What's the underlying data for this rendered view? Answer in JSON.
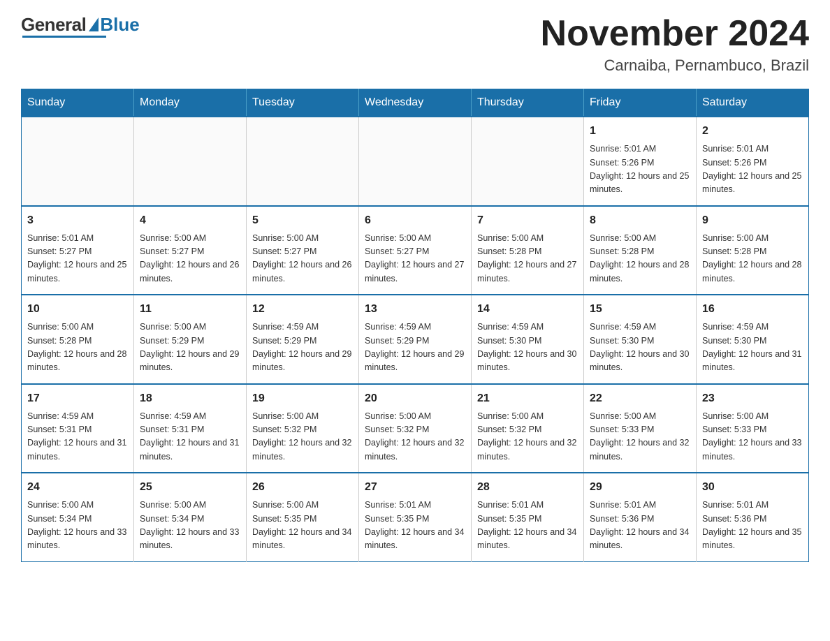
{
  "logo": {
    "general": "General",
    "blue": "Blue",
    "triangle_color": "#1a6fa8"
  },
  "header": {
    "month_year": "November 2024",
    "location": "Carnaiba, Pernambuco, Brazil"
  },
  "weekdays": [
    "Sunday",
    "Monday",
    "Tuesday",
    "Wednesday",
    "Thursday",
    "Friday",
    "Saturday"
  ],
  "weeks": [
    [
      {
        "day": "",
        "sunrise": "",
        "sunset": "",
        "daylight": ""
      },
      {
        "day": "",
        "sunrise": "",
        "sunset": "",
        "daylight": ""
      },
      {
        "day": "",
        "sunrise": "",
        "sunset": "",
        "daylight": ""
      },
      {
        "day": "",
        "sunrise": "",
        "sunset": "",
        "daylight": ""
      },
      {
        "day": "",
        "sunrise": "",
        "sunset": "",
        "daylight": ""
      },
      {
        "day": "1",
        "sunrise": "Sunrise: 5:01 AM",
        "sunset": "Sunset: 5:26 PM",
        "daylight": "Daylight: 12 hours and 25 minutes."
      },
      {
        "day": "2",
        "sunrise": "Sunrise: 5:01 AM",
        "sunset": "Sunset: 5:26 PM",
        "daylight": "Daylight: 12 hours and 25 minutes."
      }
    ],
    [
      {
        "day": "3",
        "sunrise": "Sunrise: 5:01 AM",
        "sunset": "Sunset: 5:27 PM",
        "daylight": "Daylight: 12 hours and 25 minutes."
      },
      {
        "day": "4",
        "sunrise": "Sunrise: 5:00 AM",
        "sunset": "Sunset: 5:27 PM",
        "daylight": "Daylight: 12 hours and 26 minutes."
      },
      {
        "day": "5",
        "sunrise": "Sunrise: 5:00 AM",
        "sunset": "Sunset: 5:27 PM",
        "daylight": "Daylight: 12 hours and 26 minutes."
      },
      {
        "day": "6",
        "sunrise": "Sunrise: 5:00 AM",
        "sunset": "Sunset: 5:27 PM",
        "daylight": "Daylight: 12 hours and 27 minutes."
      },
      {
        "day": "7",
        "sunrise": "Sunrise: 5:00 AM",
        "sunset": "Sunset: 5:28 PM",
        "daylight": "Daylight: 12 hours and 27 minutes."
      },
      {
        "day": "8",
        "sunrise": "Sunrise: 5:00 AM",
        "sunset": "Sunset: 5:28 PM",
        "daylight": "Daylight: 12 hours and 28 minutes."
      },
      {
        "day": "9",
        "sunrise": "Sunrise: 5:00 AM",
        "sunset": "Sunset: 5:28 PM",
        "daylight": "Daylight: 12 hours and 28 minutes."
      }
    ],
    [
      {
        "day": "10",
        "sunrise": "Sunrise: 5:00 AM",
        "sunset": "Sunset: 5:28 PM",
        "daylight": "Daylight: 12 hours and 28 minutes."
      },
      {
        "day": "11",
        "sunrise": "Sunrise: 5:00 AM",
        "sunset": "Sunset: 5:29 PM",
        "daylight": "Daylight: 12 hours and 29 minutes."
      },
      {
        "day": "12",
        "sunrise": "Sunrise: 4:59 AM",
        "sunset": "Sunset: 5:29 PM",
        "daylight": "Daylight: 12 hours and 29 minutes."
      },
      {
        "day": "13",
        "sunrise": "Sunrise: 4:59 AM",
        "sunset": "Sunset: 5:29 PM",
        "daylight": "Daylight: 12 hours and 29 minutes."
      },
      {
        "day": "14",
        "sunrise": "Sunrise: 4:59 AM",
        "sunset": "Sunset: 5:30 PM",
        "daylight": "Daylight: 12 hours and 30 minutes."
      },
      {
        "day": "15",
        "sunrise": "Sunrise: 4:59 AM",
        "sunset": "Sunset: 5:30 PM",
        "daylight": "Daylight: 12 hours and 30 minutes."
      },
      {
        "day": "16",
        "sunrise": "Sunrise: 4:59 AM",
        "sunset": "Sunset: 5:30 PM",
        "daylight": "Daylight: 12 hours and 31 minutes."
      }
    ],
    [
      {
        "day": "17",
        "sunrise": "Sunrise: 4:59 AM",
        "sunset": "Sunset: 5:31 PM",
        "daylight": "Daylight: 12 hours and 31 minutes."
      },
      {
        "day": "18",
        "sunrise": "Sunrise: 4:59 AM",
        "sunset": "Sunset: 5:31 PM",
        "daylight": "Daylight: 12 hours and 31 minutes."
      },
      {
        "day": "19",
        "sunrise": "Sunrise: 5:00 AM",
        "sunset": "Sunset: 5:32 PM",
        "daylight": "Daylight: 12 hours and 32 minutes."
      },
      {
        "day": "20",
        "sunrise": "Sunrise: 5:00 AM",
        "sunset": "Sunset: 5:32 PM",
        "daylight": "Daylight: 12 hours and 32 minutes."
      },
      {
        "day": "21",
        "sunrise": "Sunrise: 5:00 AM",
        "sunset": "Sunset: 5:32 PM",
        "daylight": "Daylight: 12 hours and 32 minutes."
      },
      {
        "day": "22",
        "sunrise": "Sunrise: 5:00 AM",
        "sunset": "Sunset: 5:33 PM",
        "daylight": "Daylight: 12 hours and 32 minutes."
      },
      {
        "day": "23",
        "sunrise": "Sunrise: 5:00 AM",
        "sunset": "Sunset: 5:33 PM",
        "daylight": "Daylight: 12 hours and 33 minutes."
      }
    ],
    [
      {
        "day": "24",
        "sunrise": "Sunrise: 5:00 AM",
        "sunset": "Sunset: 5:34 PM",
        "daylight": "Daylight: 12 hours and 33 minutes."
      },
      {
        "day": "25",
        "sunrise": "Sunrise: 5:00 AM",
        "sunset": "Sunset: 5:34 PM",
        "daylight": "Daylight: 12 hours and 33 minutes."
      },
      {
        "day": "26",
        "sunrise": "Sunrise: 5:00 AM",
        "sunset": "Sunset: 5:35 PM",
        "daylight": "Daylight: 12 hours and 34 minutes."
      },
      {
        "day": "27",
        "sunrise": "Sunrise: 5:01 AM",
        "sunset": "Sunset: 5:35 PM",
        "daylight": "Daylight: 12 hours and 34 minutes."
      },
      {
        "day": "28",
        "sunrise": "Sunrise: 5:01 AM",
        "sunset": "Sunset: 5:35 PM",
        "daylight": "Daylight: 12 hours and 34 minutes."
      },
      {
        "day": "29",
        "sunrise": "Sunrise: 5:01 AM",
        "sunset": "Sunset: 5:36 PM",
        "daylight": "Daylight: 12 hours and 34 minutes."
      },
      {
        "day": "30",
        "sunrise": "Sunrise: 5:01 AM",
        "sunset": "Sunset: 5:36 PM",
        "daylight": "Daylight: 12 hours and 35 minutes."
      }
    ]
  ]
}
